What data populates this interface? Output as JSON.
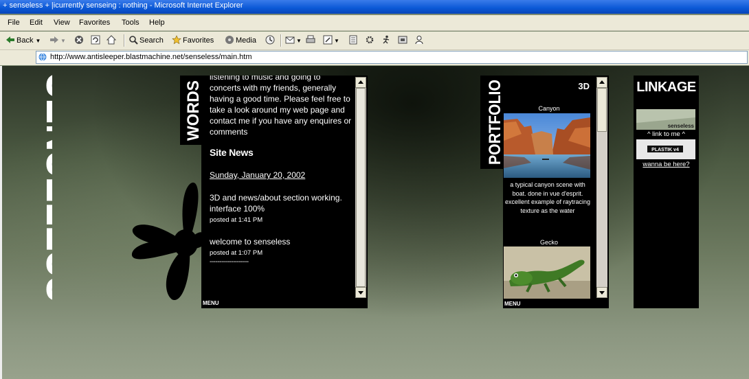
{
  "window": {
    "title": "+ senseless + |icurrently senseing : nothing - Microsoft Internet Explorer"
  },
  "menu": {
    "items": [
      "File",
      "Edit",
      "View",
      "Favorites",
      "Tools",
      "Help"
    ]
  },
  "toolbar": {
    "back": "Back",
    "search": "Search",
    "favorites": "Favorites",
    "media": "Media"
  },
  "address": {
    "url": "http://www.antisleeper.blastmachine.net/senseless/main.htm"
  },
  "site": {
    "logo": "SENSELESS",
    "words": {
      "tab": "WORDS",
      "intro": "listening to music and going to concerts with my friends, generally having a good time. Please feel free to take a look around my web page and contact me if you have any enquires or comments",
      "news_heading": "Site News",
      "date": "Sunday, January 20, 2002",
      "posts": [
        {
          "text": "3D and news/about section working. interface 100%",
          "posted": "posted at 1:41 PM"
        },
        {
          "text": "welcome to senseless",
          "posted": "posted at 1:07 PM"
        }
      ],
      "divider": "--------------------",
      "menu": "MENU"
    },
    "portfolio": {
      "tab": "PORTFOLIO",
      "category": "3D",
      "items": [
        {
          "title": "Canyon",
          "desc": "a typical canyon scene with boat. done in vue d'esprit. excellent example of raytracing texture as the water"
        },
        {
          "title": "Gecko"
        }
      ],
      "menu": "MENU"
    },
    "linkage": {
      "title": "LINKAGE",
      "banner1_text": "senseless",
      "link_to_me": "^ link to me ^",
      "banner2_text": "PLASTIK v4",
      "wanna": "wanna be here?"
    }
  },
  "colors": {
    "titlebar": "#0a58d6",
    "chrome": "#ece9d8",
    "panel": "#000000"
  }
}
